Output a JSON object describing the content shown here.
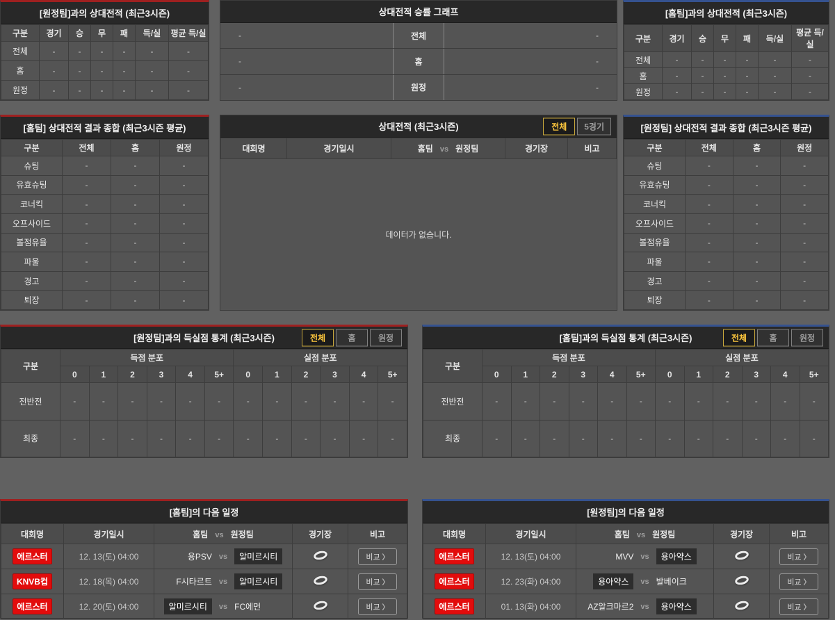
{
  "shared": {
    "vs": "vs",
    "home_col": "홈팀",
    "away_col": "원정팀",
    "compare_label": "비교",
    "compare_chevron": "〉",
    "venue_icon": "stadium-icon"
  },
  "colors": {
    "accent_red": "#9e2020",
    "accent_blue": "#35528f",
    "tab_active_text": "#ffc83d",
    "badge_red": "#e20c0c",
    "panel_bg": "#545454",
    "titlebar_bg": "#282828"
  },
  "away_h2h": {
    "title": "[원정팀]과의 상대전적 (최근3시즌)",
    "columns": [
      "구분",
      "경기",
      "승",
      "무",
      "패",
      "득/실",
      "평균 득/실"
    ],
    "rows": [
      {
        "label": "전체",
        "values": [
          "-",
          "-",
          "-",
          "-",
          "-",
          "-"
        ]
      },
      {
        "label": "홈",
        "values": [
          "-",
          "-",
          "-",
          "-",
          "-",
          "-"
        ]
      },
      {
        "label": "원정",
        "values": [
          "-",
          "-",
          "-",
          "-",
          "-",
          "-"
        ]
      }
    ]
  },
  "winrate_graph": {
    "title": "상대전적 승률 그래프",
    "rows": [
      {
        "label": "전체",
        "left": "-",
        "right": "-"
      },
      {
        "label": "홈",
        "left": "-",
        "right": "-"
      },
      {
        "label": "원정",
        "left": "-",
        "right": "-"
      }
    ]
  },
  "home_h2h": {
    "title": "[홈팀]과의 상대전적 (최근3시즌)",
    "columns": [
      "구분",
      "경기",
      "승",
      "무",
      "패",
      "득/실",
      "평균 득/실"
    ],
    "rows": [
      {
        "label": "전체",
        "values": [
          "-",
          "-",
          "-",
          "-",
          "-",
          "-"
        ]
      },
      {
        "label": "홈",
        "values": [
          "-",
          "-",
          "-",
          "-",
          "-",
          "-"
        ]
      },
      {
        "label": "원정",
        "values": [
          "-",
          "-",
          "-",
          "-",
          "-",
          "-"
        ]
      }
    ]
  },
  "home_result_summary": {
    "title": "[홈팀] 상대전적 결과 종합 (최근3시즌 평균)",
    "columns": [
      "구분",
      "전체",
      "홈",
      "원정"
    ],
    "rows": [
      {
        "label": "슈팅",
        "values": [
          "-",
          "-",
          "-"
        ]
      },
      {
        "label": "유효슈팅",
        "values": [
          "-",
          "-",
          "-"
        ]
      },
      {
        "label": "코너킥",
        "values": [
          "-",
          "-",
          "-"
        ]
      },
      {
        "label": "오프사이드",
        "values": [
          "-",
          "-",
          "-"
        ]
      },
      {
        "label": "볼점유율",
        "values": [
          "-",
          "-",
          "-"
        ]
      },
      {
        "label": "파울",
        "values": [
          "-",
          "-",
          "-"
        ]
      },
      {
        "label": "경고",
        "values": [
          "-",
          "-",
          "-"
        ]
      },
      {
        "label": "퇴장",
        "values": [
          "-",
          "-",
          "-"
        ]
      }
    ]
  },
  "h2h_matches": {
    "title": "상대전적 (최근3시즌)",
    "tabs": [
      "전체",
      "5경기"
    ],
    "columns": [
      "대회명",
      "경기일시",
      "경기장",
      "비고"
    ],
    "empty_message": "데이터가 없습니다."
  },
  "away_result_summary": {
    "title": "[원정팀] 상대전적 결과 종합 (최근3시즌 평균)",
    "columns": [
      "구분",
      "전체",
      "홈",
      "원정"
    ],
    "rows": [
      {
        "label": "슈팅",
        "values": [
          "-",
          "-",
          "-"
        ]
      },
      {
        "label": "유효슈팅",
        "values": [
          "-",
          "-",
          "-"
        ]
      },
      {
        "label": "코너킥",
        "values": [
          "-",
          "-",
          "-"
        ]
      },
      {
        "label": "오프사이드",
        "values": [
          "-",
          "-",
          "-"
        ]
      },
      {
        "label": "볼점유율",
        "values": [
          "-",
          "-",
          "-"
        ]
      },
      {
        "label": "파울",
        "values": [
          "-",
          "-",
          "-"
        ]
      },
      {
        "label": "경고",
        "values": [
          "-",
          "-",
          "-"
        ]
      },
      {
        "label": "퇴장",
        "values": [
          "-",
          "-",
          "-"
        ]
      }
    ]
  },
  "away_goal_stats": {
    "title": "[원정팀]과의 득실점 통계 (최근3시즌)",
    "tabs": [
      "전체",
      "홈",
      "원정"
    ],
    "corner_header": "구분",
    "scored_group": "득점 분포",
    "conceded_group": "실점 분포",
    "bins": [
      "0",
      "1",
      "2",
      "3",
      "4",
      "5+"
    ],
    "rows": [
      {
        "label": "전반전",
        "values": [
          "-",
          "-",
          "-",
          "-",
          "-",
          "-",
          "-",
          "-",
          "-",
          "-",
          "-",
          "-"
        ]
      },
      {
        "label": "최종",
        "values": [
          "-",
          "-",
          "-",
          "-",
          "-",
          "-",
          "-",
          "-",
          "-",
          "-",
          "-",
          "-"
        ]
      }
    ]
  },
  "home_goal_stats": {
    "title": "[홈팀]과의 득실점 통계 (최근3시즌)",
    "tabs": [
      "전체",
      "홈",
      "원정"
    ],
    "corner_header": "구분",
    "scored_group": "득점 분포",
    "conceded_group": "실점 분포",
    "bins": [
      "0",
      "1",
      "2",
      "3",
      "4",
      "5+"
    ],
    "rows": [
      {
        "label": "전반전",
        "values": [
          "-",
          "-",
          "-",
          "-",
          "-",
          "-",
          "-",
          "-",
          "-",
          "-",
          "-",
          "-"
        ]
      },
      {
        "label": "최종",
        "values": [
          "-",
          "-",
          "-",
          "-",
          "-",
          "-",
          "-",
          "-",
          "-",
          "-",
          "-",
          "-"
        ]
      }
    ]
  },
  "home_schedule": {
    "title": "[홈팀]의 다음 일정",
    "columns": [
      "대회명",
      "경기일시",
      "경기장",
      "비고"
    ],
    "rows": [
      {
        "league": "에르스터",
        "datetime": "12. 13(토) 04:00",
        "home": "용PSV",
        "away": "알미르시티"
      },
      {
        "league": "KNVB컵",
        "datetime": "12. 18(목) 04:00",
        "home": "F시타르트",
        "away": "알미르시티"
      },
      {
        "league": "에르스터",
        "datetime": "12. 20(토) 04:00",
        "home": "알미르시티",
        "away": "FC에먼"
      }
    ]
  },
  "away_schedule": {
    "title": "[원정팀]의 다음 일정",
    "columns": [
      "대회명",
      "경기일시",
      "경기장",
      "비고"
    ],
    "rows": [
      {
        "league": "에르스터",
        "datetime": "12. 13(토) 04:00",
        "home": "MVV",
        "away": "용아약스"
      },
      {
        "league": "에르스터",
        "datetime": "12. 23(화) 04:00",
        "home": "용아약스",
        "away": "발베이크"
      },
      {
        "league": "에르스터",
        "datetime": "01. 13(화) 04:00",
        "home": "AZ알크마르2",
        "away": "용아약스"
      }
    ]
  }
}
